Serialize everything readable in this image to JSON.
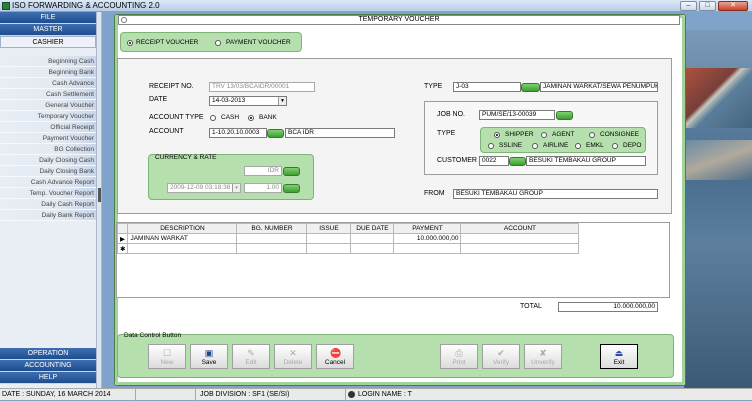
{
  "app": {
    "title": "ISO FORWARDING & ACCOUNTING 2.0"
  },
  "sidebar": {
    "file": "FILE",
    "master": "MASTER",
    "cashier": "CASHIER",
    "items": [
      "Beginning Cash",
      "Beginning Bank",
      "Cash Advance",
      "Cash Settlement",
      "General Voucher",
      "Temporary Voucher",
      "Official Receipt",
      "Payment Voucher",
      "BG Collection",
      "Daily Closing Cash",
      "Daily Closing Bank",
      "Cash Advance Report",
      "Temp. Voucher Report",
      "Daily Cash Report",
      "Daily Bank Report"
    ],
    "operation": "OPERATION",
    "accounting": "ACCOUNTING",
    "help": "HELP"
  },
  "window": {
    "title": "TEMPORARY VOUCHER",
    "voucher_type": {
      "receipt": "RECEIPT VOUCHER",
      "payment": "PAYMENT VOUCHER",
      "selected": "receipt"
    },
    "receipt_no": {
      "label": "RECEIPT NO.",
      "value": "TRV 13/03/BCAIDR/00001"
    },
    "date": {
      "label": "DATE",
      "value": "14-03-2013"
    },
    "account_type": {
      "label": "ACCOUNT TYPE",
      "cash": "CASH",
      "bank": "BANK",
      "selected": "bank"
    },
    "account": {
      "label": "ACCOUNT",
      "code": "1-10.20.10.0003",
      "name": "BCA IDR"
    },
    "currency": {
      "title": "CURRENCY & RATE",
      "currency": "IDR",
      "rate_date": "2009-12-09 03:18:38",
      "rate": "1.00"
    },
    "type": {
      "label": "TYPE",
      "code": "J-03",
      "name": "JAMINAN WARKAT/SEWA PENUMPUK"
    },
    "job_no": {
      "label": "JOB NO.",
      "value": "PUM/SE/13-00039"
    },
    "job_type": {
      "label": "TYPE",
      "options": [
        "SHIPPER",
        "AGENT",
        "CONSIGNEE",
        "SSLINE",
        "AIRLINE",
        "EMKL",
        "DEPO"
      ],
      "selected": "SHIPPER"
    },
    "customer": {
      "label": "CUSTOMER",
      "code": "0022",
      "name": "BESUKI TEMBAKAU GROUP"
    },
    "from": {
      "label": "FROM",
      "value": "BESUKI TEMBAKAU GROUP"
    },
    "grid": {
      "columns": [
        "DESCRIPTION",
        "BG. NUMBER",
        "ISSUE",
        "DUE DATE",
        "PAYMENT",
        "ACCOUNT"
      ],
      "rows": [
        [
          "JAMINAN WARKAT",
          "",
          "",
          "",
          "10.000.000,00",
          ""
        ]
      ]
    },
    "total": {
      "label": "TOTAL",
      "value": "10.000.000,00"
    },
    "control": {
      "title": "Data Control Button",
      "new": "New",
      "save": "Save",
      "edit": "Edit",
      "delete": "Delete",
      "cancel": "Cancel",
      "print": "Print",
      "verify": "Verify",
      "unverify": "Unverify",
      "exit": "Exit"
    }
  },
  "status": {
    "date": "DATE : SUNDAY, 16 MARCH 2014",
    "division": "JOB DIVISION  : SF1 (SE/SI)",
    "login": "LOGIN NAME  : T"
  }
}
